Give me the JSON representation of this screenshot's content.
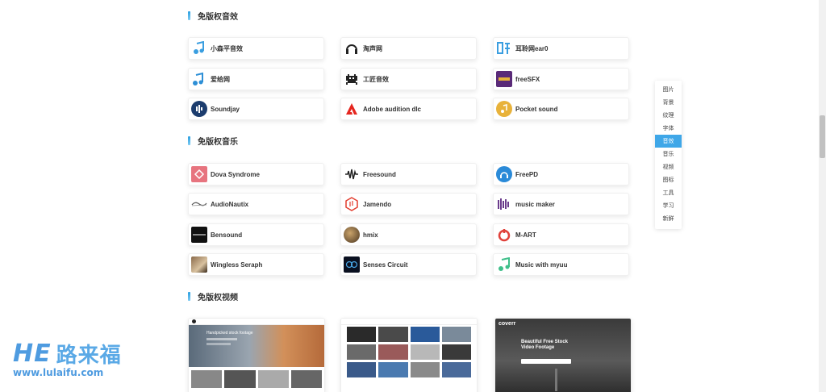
{
  "sections": {
    "sound": {
      "title": "免版权音效"
    },
    "music": {
      "title": "免版权音乐"
    },
    "video": {
      "title": "免版权视频"
    }
  },
  "sound_cards": [
    "小森平音效",
    "淘声网",
    "耳聆网ear0",
    "爱给网",
    "工匠音效",
    "freeSFX",
    "Soundjay",
    "Adobe audition dlc",
    "Pocket sound"
  ],
  "music_cards": [
    "Dova Syndrome",
    "Freesound",
    "FreePD",
    "AudioNautix",
    "Jamendo",
    "music maker",
    "Bensound",
    "hmix",
    "M-ART",
    "Wingless Seraph",
    "Senses Circuit",
    "Music with myuu"
  ],
  "video_thumbs": {
    "first": {
      "headline": "Handpicked stock footage"
    },
    "third": {
      "brand": "coverr",
      "headline": "Beautiful Free Stock Video Footage"
    }
  },
  "sidenav": {
    "items": [
      "图片",
      "背景",
      "纹理",
      "字体",
      "音效",
      "音乐",
      "视频",
      "图标",
      "工具",
      "学习",
      "新鲜"
    ],
    "active": "音效"
  },
  "logo": {
    "mark": "HE",
    "name": "路来福",
    "url": "www.lulaifu.com"
  },
  "colors": {
    "accent": "#3fa7e8",
    "logo": "#4e9be0"
  }
}
